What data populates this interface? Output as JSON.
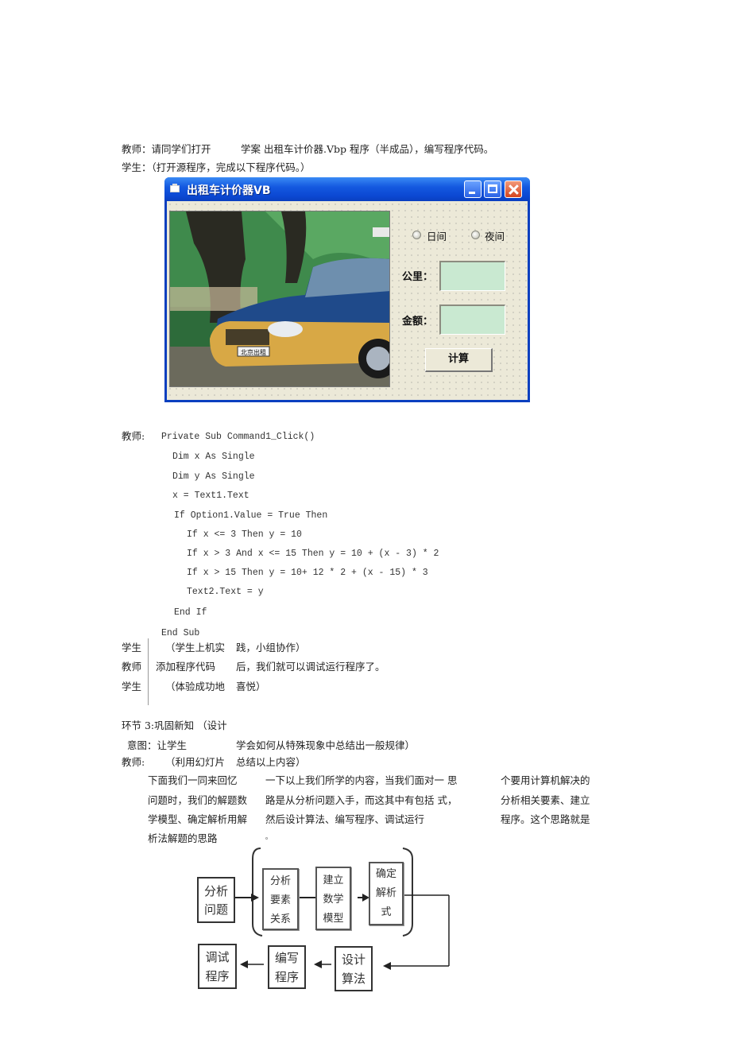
{
  "doc": {
    "line1": "教师：请同学们打开　　　学案 出租车计价器.Vbp 程序（半成品），编写程序代码。",
    "line2": "学生：（打开源程序，完成以下程序代码。）"
  },
  "vb_window": {
    "title": "出租车计价器VB",
    "radio_day": "日间",
    "radio_night": "夜间",
    "label_km": "公里：",
    "label_amount": "金额：",
    "button_calc": "计算",
    "photo_plate": "北京出租"
  },
  "code": {
    "speaker": "教师:",
    "lines": [
      "Private Sub Command1_Click()",
      "Dim x As Single",
      "Dim y As Single",
      "x = Text1.Text",
      "If Option1.Value = True Then",
      "If x <= 3 Then y = 10",
      "If x > 3 And x <= 15 Then y = 10 + (x - 3) * 2",
      "If x > 15 Then y = 10+ 12 * 2 + (x - 15) * 3",
      "Text2.Text = y",
      "End If",
      "End Sub"
    ]
  },
  "dialogue": [
    {
      "speaker": "学生",
      "a": "（学生上机实",
      "b": "践，小组协作）"
    },
    {
      "speaker": "教师",
      "a": "添加程序代码",
      "b": "后，我们就可以调试运行程序了。"
    },
    {
      "speaker": "学生",
      "a": "（体验成功地",
      "b": "喜悦）"
    }
  ],
  "section": {
    "heading": "环节 3:巩固新知 （设计",
    "intent_a": "意图：让学生",
    "intent_b": "学会如何从特殊现象中总结出一般规律）",
    "teacher_a": "教师:",
    "teacher_b": "（利用幻灯片",
    "teacher_c": "总结以上内容）"
  },
  "paragraph": {
    "col1": [
      "下面我们一同来回忆",
      "问题时，我们的解题数",
      "学模型、确定解析用解",
      "析法解题的思路"
    ],
    "col2": [
      "一下以上我们所学的内容，当我们面对一 思",
      "路是从分析问题入手，而这其中有包括 式，",
      "然后设计算法、编写程序、调试运行",
      "。"
    ],
    "col3": [
      "个要用计算机解决的",
      "分析相关要素、建立",
      "程序。这个思路就是"
    ]
  },
  "flowchart": {
    "analyze_problem": [
      "分析",
      "问题"
    ],
    "analyze_elements": [
      "分析",
      "要素",
      "关系"
    ],
    "build_model": [
      "建立",
      "数学",
      "模型"
    ],
    "determine_formula": [
      "确定",
      "解析",
      "式"
    ],
    "design_algorithm": [
      "设计",
      "算法"
    ],
    "write_program": [
      "编写",
      "程序"
    ],
    "debug_program": [
      "调试",
      "程序"
    ]
  }
}
